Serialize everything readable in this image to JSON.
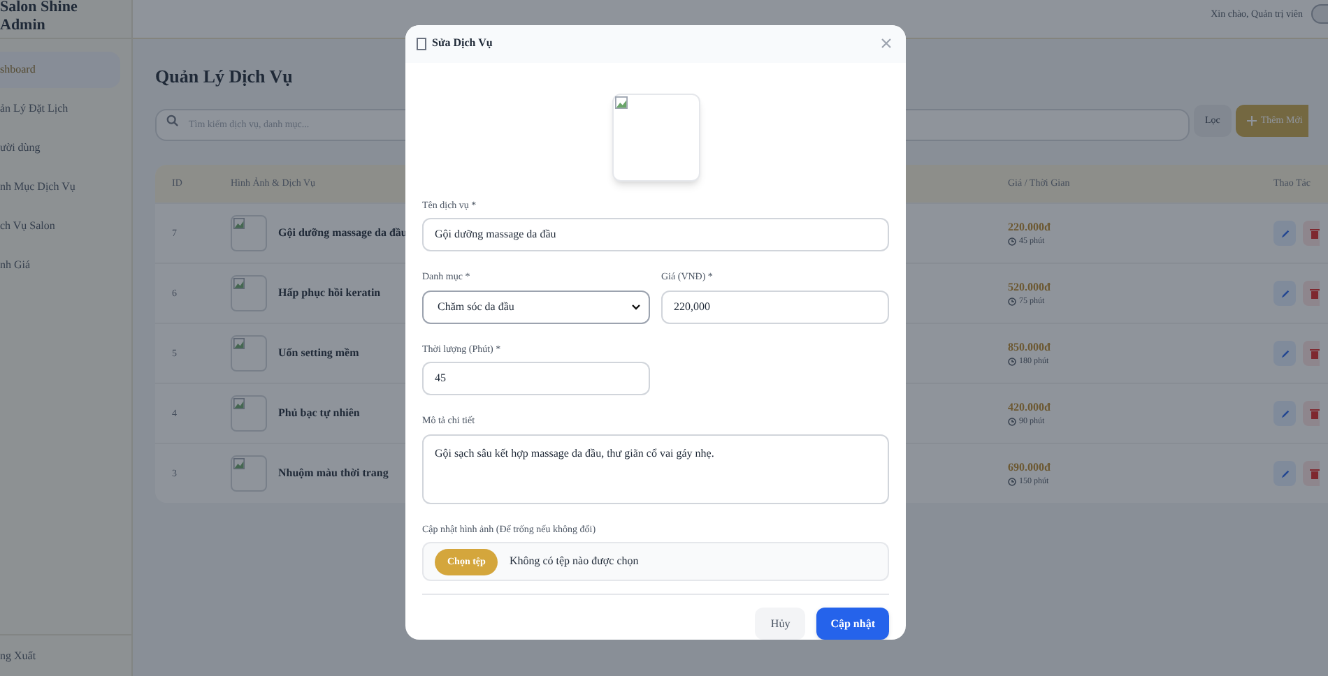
{
  "sidebar": {
    "brand": [
      "Salon Shine",
      "Admin"
    ],
    "items": [
      {
        "label": "shboard",
        "selected": true
      },
      {
        "label": "ản Lý Đặt Lịch",
        "selected": false
      },
      {
        "label": "ười dùng",
        "selected": false
      },
      {
        "label": "nh Mục Dịch Vụ",
        "selected": false
      },
      {
        "label": "ch Vụ Salon",
        "selected": false
      },
      {
        "label": "nh Giá",
        "selected": false
      }
    ],
    "logout": "ng Xuất"
  },
  "header": {
    "greeting": "Xin chào, Quản trị viên"
  },
  "page_title": "Quản Lý Dịch Vụ",
  "search": {
    "placeholder": "Tìm kiếm dịch vụ, danh mục..."
  },
  "filter_button": "Lọc",
  "add_button": "Thêm Mới",
  "table": {
    "columns": [
      "ID",
      "Hình Ảnh & Dịch Vụ",
      "Giá / Thời Gian",
      "Thao Tác"
    ],
    "rows": [
      {
        "id": "7",
        "name": "Gội dưỡng massage da đầu",
        "price": "220.000đ",
        "duration": "45 phút"
      },
      {
        "id": "6",
        "name": "Hấp phục hồi keratin",
        "price": "520.000đ",
        "duration": "75 phút"
      },
      {
        "id": "5",
        "name": "Uốn setting mềm",
        "price": "850.000đ",
        "duration": "180 phút"
      },
      {
        "id": "4",
        "name": "Phủ bạc tự nhiên",
        "price": "420.000đ",
        "duration": "90 phút"
      },
      {
        "id": "3",
        "name": "Nhuộm màu thời trang",
        "price": "690.000đ",
        "duration": "150 phút"
      }
    ]
  },
  "modal": {
    "title": "Sửa Dịch Vụ",
    "rows": [
      [
        {
          "kind": "text",
          "label": "Tên dịch vụ *",
          "value": "Gội dưỡng massage da đầu"
        }
      ],
      [
        {
          "kind": "select",
          "label": "Danh mục *",
          "value": "Chăm sóc da đầu"
        },
        {
          "kind": "number",
          "label": "Giá (VNĐ) *",
          "value": "220,000"
        }
      ],
      [
        {
          "kind": "number",
          "label": "Thời lượng (Phút) *",
          "value": "45"
        }
      ],
      [
        {
          "kind": "textarea",
          "label": "Mô tả chi tiết",
          "value": "Gội sạch sâu kết hợp massage da đầu, thư giãn cổ vai gáy nhẹ."
        }
      ],
      [
        {
          "kind": "file",
          "label": "Cập nhật hình ảnh (Để trống nếu không đổi)",
          "button": "Chọn tệp",
          "value": "Không có tệp nào được chọn"
        }
      ]
    ],
    "cancel_button": "Hủy",
    "submit_button": "Cập nhật"
  }
}
